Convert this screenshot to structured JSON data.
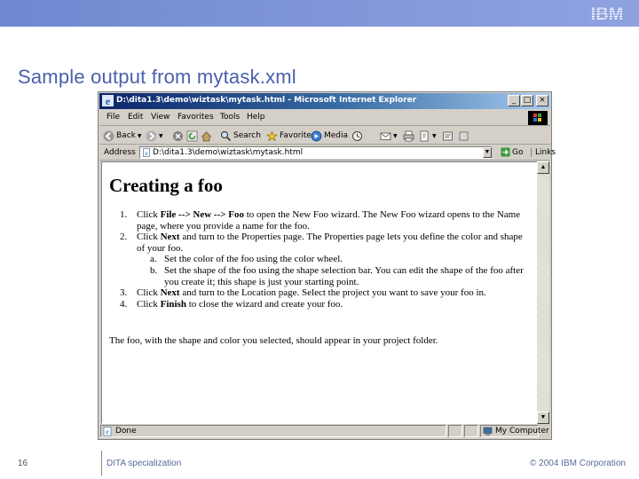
{
  "slide": {
    "brand": "IBM",
    "title": "Sample output from mytask.xml",
    "footer": {
      "page_number": "16",
      "left_text": "DITA specialization",
      "right_text": "© 2004 IBM Corporation"
    }
  },
  "browser": {
    "title": "D:\\dita1.3\\demo\\wiztask\\mytask.html - Microsoft Internet Explorer",
    "menu": [
      "File",
      "Edit",
      "View",
      "Favorites",
      "Tools",
      "Help"
    ],
    "toolbar": {
      "back_label": "Back",
      "search_label": "Search",
      "favorites_label": "Favorites",
      "media_label": "Media"
    },
    "address": {
      "label": "Address",
      "value": "D:\\dita1.3\\demo\\wiztask\\mytask.html",
      "go_label": "Go",
      "links_label": "Links"
    },
    "status": {
      "text": "Done",
      "zone": "My Computer"
    }
  },
  "document": {
    "heading": "Creating a foo",
    "steps": [
      {
        "num": "1.",
        "pre": "Click ",
        "bold1": "File --> New --> Foo",
        "post": " to open the New Foo wizard. The New Foo wizard opens to the Name page, where you provide a name for the foo."
      },
      {
        "num": "2.",
        "pre": "Click ",
        "bold1": "Next",
        "post": " and turn to the Properties page. The Properties page lets you define the color and shape of your foo."
      },
      {
        "num": "3.",
        "pre": "Click ",
        "bold1": "Next",
        "post": " and turn to the Location page. Select the project you want to save your foo in."
      },
      {
        "num": "4.",
        "pre": "Click ",
        "bold1": "Finish",
        "post": " to close the wizard and create your foo."
      }
    ],
    "substeps": [
      {
        "num": "a.",
        "text": "Set the color of the foo using the color wheel."
      },
      {
        "num": "b.",
        "text": "Set the shape of the foo using the shape selection bar. You can edit the shape of the foo after you create it; this shape is just your starting point."
      }
    ],
    "result": "The foo, with the shape and color you selected, should appear in your project folder."
  }
}
